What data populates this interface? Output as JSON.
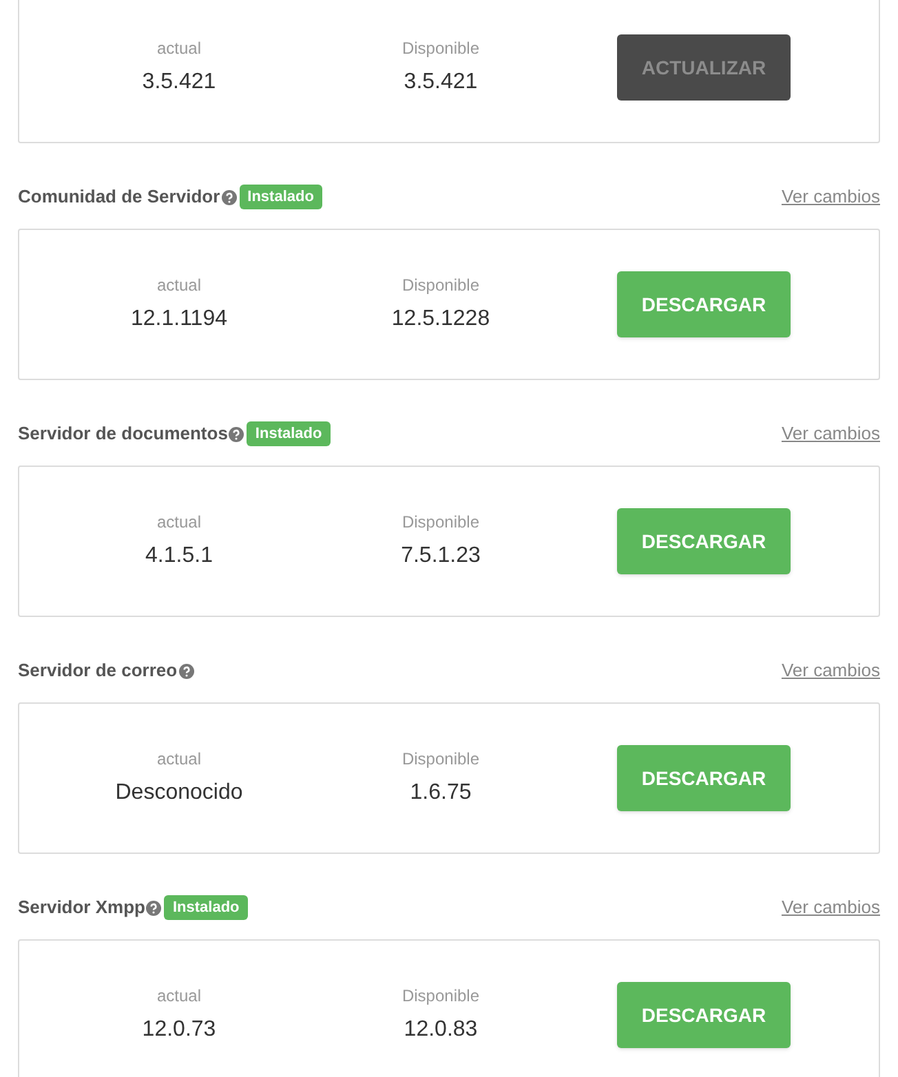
{
  "sections": [
    {
      "current_label": "actual",
      "current": "3.5.421",
      "available_label": "Disponible",
      "available": "3.5.421",
      "button": {
        "label": "ACTUALIZAR",
        "kind": "update",
        "disabled": true
      }
    },
    {
      "title": "Comunidad de Servidor",
      "badge": "Instalado",
      "link": "Ver cambios",
      "current_label": "actual",
      "current": "12.1.1194",
      "available_label": "Disponible",
      "available": "12.5.1228",
      "button": {
        "label": "DESCARGAR",
        "kind": "download",
        "disabled": false
      }
    },
    {
      "title": "Servidor de documentos",
      "badge": "Instalado",
      "link": "Ver cambios",
      "current_label": "actual",
      "current": "4.1.5.1",
      "available_label": "Disponible",
      "available": "7.5.1.23",
      "button": {
        "label": "DESCARGAR",
        "kind": "download",
        "disabled": false
      }
    },
    {
      "title": "Servidor de correo",
      "link": "Ver cambios",
      "current_label": "actual",
      "current": "Desconocido",
      "available_label": "Disponible",
      "available": "1.6.75",
      "button": {
        "label": "DESCARGAR",
        "kind": "download",
        "disabled": false
      }
    },
    {
      "title": "Servidor Xmpp",
      "badge": "Instalado",
      "link": "Ver cambios",
      "current_label": "actual",
      "current": "12.0.73",
      "available_label": "Disponible",
      "available": "12.0.83",
      "button": {
        "label": "DESCARGAR",
        "kind": "download",
        "disabled": false
      }
    }
  ]
}
